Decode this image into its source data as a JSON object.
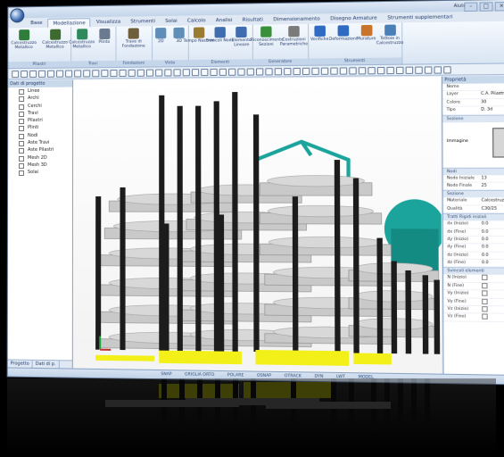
{
  "app": {
    "tabs": [
      {
        "label": "Base"
      },
      {
        "label": "Modellazione"
      },
      {
        "label": "Visualizza"
      },
      {
        "label": "Strumenti"
      },
      {
        "label": "Solai"
      },
      {
        "label": "Calcolo"
      },
      {
        "label": "Analisi"
      },
      {
        "label": "Risultati"
      },
      {
        "label": "Dimensionamento"
      },
      {
        "label": "Disegno Armature"
      },
      {
        "label": "Strumenti supplementari"
      }
    ],
    "active_tab": "Modellazione",
    "help_label": "Aiuto"
  },
  "ribbon": {
    "buttons": [
      {
        "label": "Calcestruzzo Metallico",
        "color": "#2f7d3a"
      },
      {
        "label": "Calcestruzzo Metallico",
        "color": "#3d6a2e"
      },
      {
        "label": "Calcestruzzo Metallico",
        "color": "#2e8a5c"
      },
      {
        "label": "Plinto",
        "color": "#6c7a8f"
      },
      {
        "label": "Trave di Fondazione",
        "color": "#6f5e3c"
      },
      {
        "label": "2D",
        "color": "#5f8eb9"
      },
      {
        "label": "3D",
        "color": "#5f8eb9"
      },
      {
        "label": "Tempo Nastrini",
        "color": "#9a7b32"
      },
      {
        "label": "Svincoli Nodo",
        "color": "#3f6db0"
      },
      {
        "label": "Elemento Lineare",
        "color": "#3f6db0"
      },
      {
        "label": "Riconoscimento Sezioni",
        "color": "#3a8f3a"
      },
      {
        "label": "Costruzioni Parametriche",
        "color": "#7a7a7a"
      },
      {
        "label": "Verifiche",
        "color": "#2f6bc2"
      },
      {
        "label": "Deformazioni",
        "color": "#2f6bc2"
      },
      {
        "label": "Murature",
        "color": "#c8742b"
      },
      {
        "label": "Tettoie in Calcestruzzo",
        "color": "#4a7fb8"
      }
    ],
    "groups": [
      {
        "label": "Pilastri"
      },
      {
        "label": "Travi"
      },
      {
        "label": "Fondazioni"
      },
      {
        "label": "Vista"
      },
      {
        "label": "Elementi"
      },
      {
        "label": "Generatore"
      },
      {
        "label": "Strumenti"
      }
    ]
  },
  "sidebar": {
    "title": "Dati di progetto",
    "items": [
      {
        "label": "Linee"
      },
      {
        "label": "Archi"
      },
      {
        "label": "Cerchi"
      },
      {
        "label": "Travi"
      },
      {
        "label": "Pilastri"
      },
      {
        "label": "Plinti"
      },
      {
        "label": "Nodi"
      },
      {
        "label": "Aste Travi"
      },
      {
        "label": "Aste Pilastri"
      },
      {
        "label": "Mesh 2D"
      },
      {
        "label": "Mesh 3D"
      },
      {
        "label": "Solai"
      }
    ],
    "bottom_tabs": [
      {
        "label": "Progetto"
      },
      {
        "label": "Dati di p."
      }
    ]
  },
  "properties": {
    "title": "Proprietà",
    "general": [
      {
        "key": "Nome",
        "value": ""
      },
      {
        "key": "Layer",
        "value": "C.A. Pilastri"
      },
      {
        "key": "Colore",
        "value": "30"
      },
      {
        "key": "Tipo",
        "value": "D. 3d"
      }
    ],
    "section_label": "Sezione",
    "image_label": "Immagine",
    "nodes_label": "Nodi",
    "nodes": [
      {
        "key": "Nodo Iniziale",
        "value": "13"
      },
      {
        "key": "Nodo Finale",
        "value": "25"
      }
    ],
    "material_label": "Sezione",
    "material": [
      {
        "key": "Materiale",
        "value": "Calcestruzzo"
      },
      {
        "key": "Qualità",
        "value": "C30/25"
      }
    ],
    "rigid_label": "Tratti Rigidi iniziali",
    "rigid": [
      {
        "key": "dx (Inizio)",
        "value": "0.0"
      },
      {
        "key": "dx (Fine)",
        "value": "0.0"
      },
      {
        "key": "dy (Inizio)",
        "value": "0.0"
      },
      {
        "key": "dy (Fine)",
        "value": "0.0"
      },
      {
        "key": "dz (Inizio)",
        "value": "0.0"
      },
      {
        "key": "dz (Fine)",
        "value": "0.0"
      }
    ],
    "release_label": "Svincoli elementi",
    "releases": [
      {
        "key": "N (Inizio)",
        "value": ""
      },
      {
        "key": "N (Fine)",
        "value": ""
      },
      {
        "key": "Vy (Inizio)",
        "value": ""
      },
      {
        "key": "Vy (Fine)",
        "value": ""
      },
      {
        "key": "Vz (Inizio)",
        "value": ""
      },
      {
        "key": "Vz (Fine)",
        "value": ""
      }
    ]
  },
  "status": {
    "items": [
      {
        "label": "SNAP"
      },
      {
        "label": "GRIGLIA ORTO"
      },
      {
        "label": "POLARE"
      },
      {
        "label": "OSNAP"
      },
      {
        "label": "OTRACK"
      },
      {
        "label": "DYN"
      },
      {
        "label": "LWT"
      },
      {
        "label": "MODEL"
      }
    ]
  },
  "colors": {
    "concrete_slab": "#c9c9c9",
    "column": "#1c1c1c",
    "steel": "#1aa49b",
    "foundation": "#f2f018",
    "ribbon_blue": "#dfe8f3"
  }
}
